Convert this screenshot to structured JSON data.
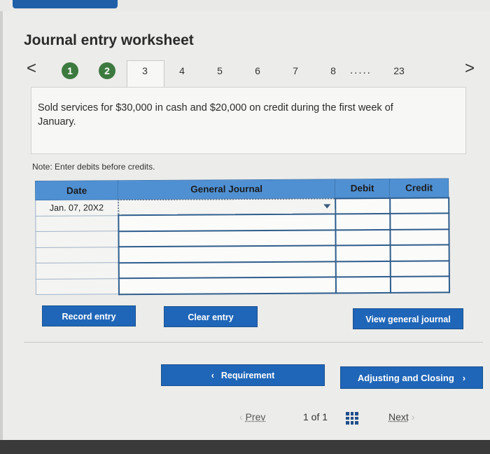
{
  "title": "Journal entry worksheet",
  "nav": {
    "prev_glyph": "<",
    "next_glyph": ">",
    "steps": [
      "1",
      "2",
      "3",
      "4",
      "5",
      "6",
      "7",
      "8",
      "23"
    ],
    "ellipsis": ".....",
    "active_step": "3"
  },
  "description": "Sold services for $30,000 in cash and $20,000 on credit during the first week of January.",
  "note": "Note: Enter debits before credits.",
  "table": {
    "headers": [
      "Date",
      "General Journal",
      "Debit",
      "Credit"
    ],
    "first_row_date": "Jan. 07, 20X2"
  },
  "buttons": {
    "record": "Record entry",
    "clear": "Clear entry",
    "view": "View general journal",
    "requirement": "Requirement",
    "adjusting": "Adjusting and Closing"
  },
  "pager": {
    "prev": "Prev",
    "count": "1 of 1",
    "next": "Next"
  },
  "colors": {
    "accent": "#1f66b8",
    "header": "#4f90d3",
    "done_step": "#3c7a3f"
  }
}
